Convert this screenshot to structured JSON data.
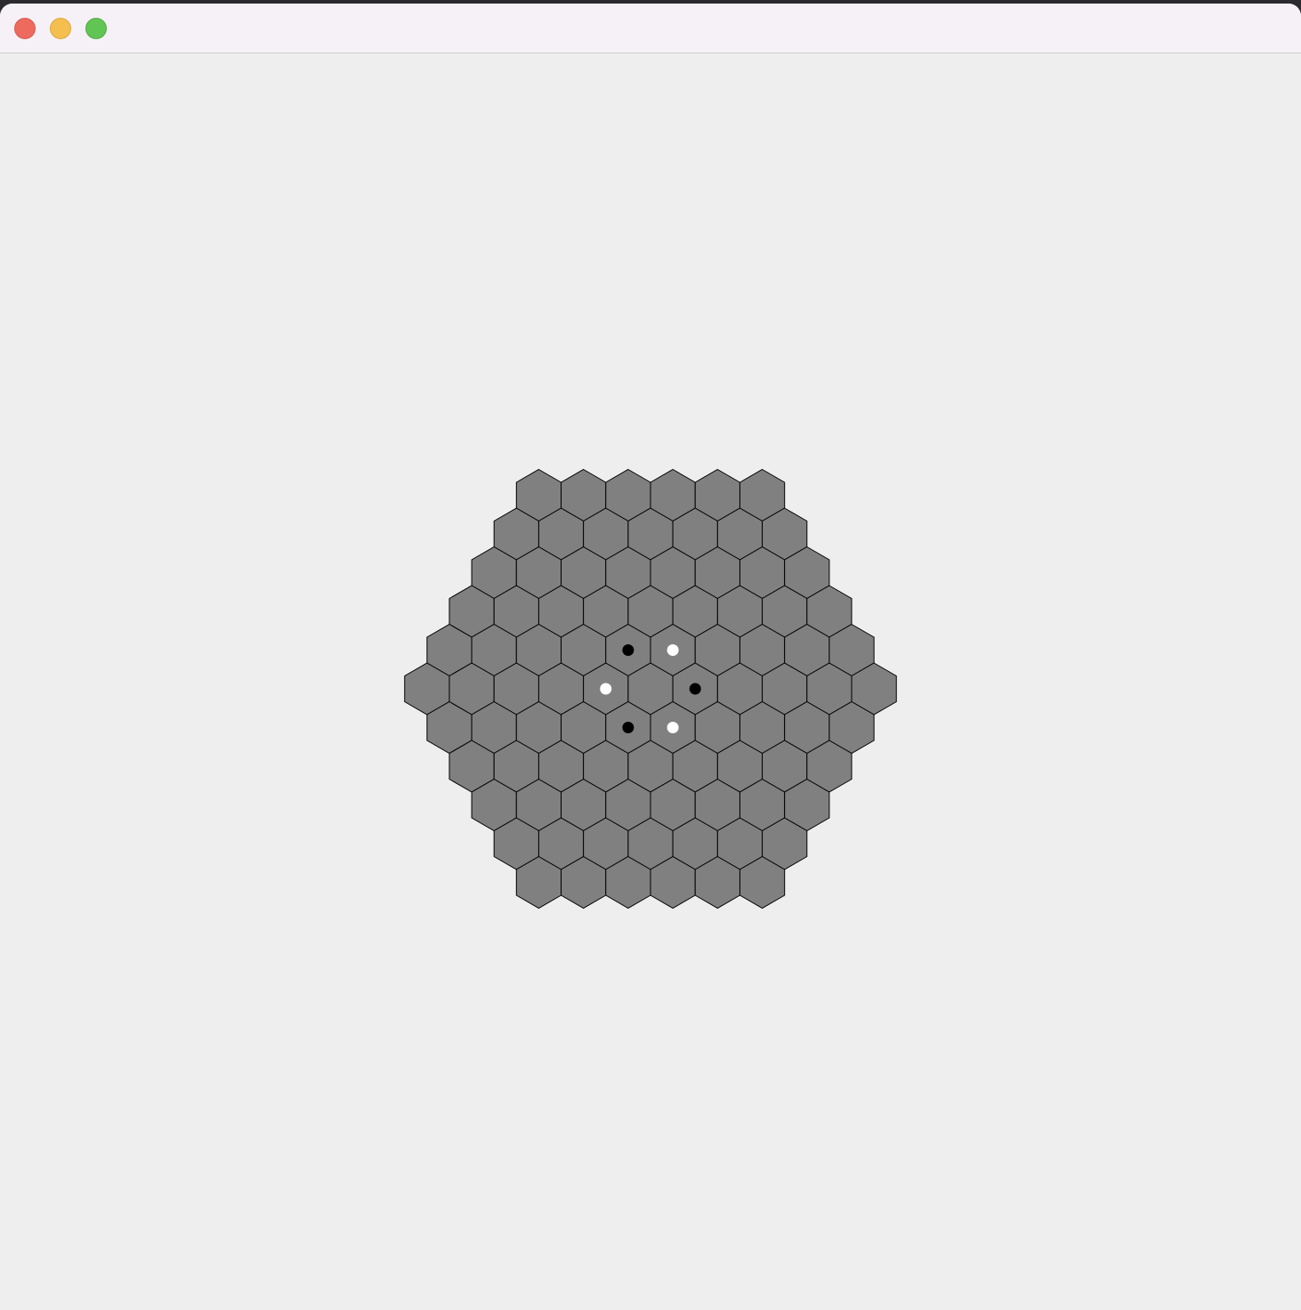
{
  "window": {
    "title": "",
    "controls": [
      "close",
      "minimize",
      "zoom"
    ]
  },
  "board": {
    "shape": "hexagon",
    "side_length": 6,
    "cell_color": "#808080",
    "cell_stroke": "#000000",
    "background": "#eeeeee",
    "pieces": [
      {
        "q": 0,
        "r": -1,
        "color": "black"
      },
      {
        "q": 1,
        "r": -1,
        "color": "white"
      },
      {
        "q": -1,
        "r": 0,
        "color": "white"
      },
      {
        "q": 1,
        "r": 0,
        "color": "black"
      },
      {
        "q": -1,
        "r": 1,
        "color": "black"
      },
      {
        "q": 0,
        "r": 1,
        "color": "white"
      }
    ]
  }
}
